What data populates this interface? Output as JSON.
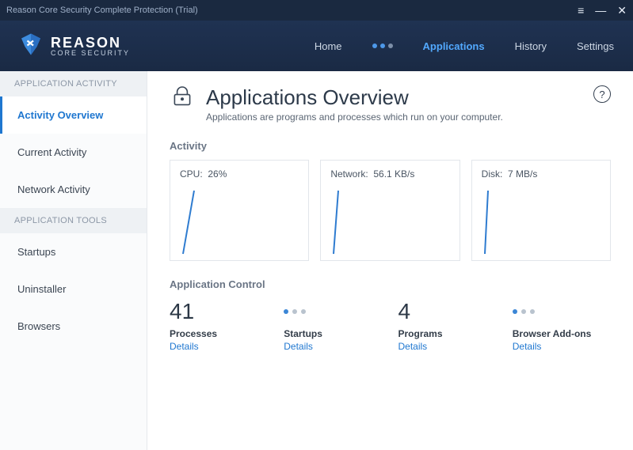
{
  "window": {
    "title": "Reason Core Security Complete Protection (Trial)"
  },
  "brand": {
    "name": "REASON",
    "sub": "CORE SECURITY"
  },
  "nav": {
    "home": "Home",
    "applications": "Applications",
    "history": "History",
    "settings": "Settings"
  },
  "sidebar": {
    "section_activity": "APPLICATION ACTIVITY",
    "section_tools": "APPLICATION TOOLS",
    "items": {
      "overview": "Activity Overview",
      "current": "Current Activity",
      "network": "Network Activity",
      "startups": "Startups",
      "uninstaller": "Uninstaller",
      "browsers": "Browsers"
    }
  },
  "page": {
    "title": "Applications Overview",
    "subtitle": "Applications are programs and processes which run on your computer."
  },
  "activity": {
    "label": "Activity",
    "cpu": {
      "name": "CPU:",
      "value": "26%"
    },
    "network": {
      "name": "Network:",
      "value": "56.1 KB/s"
    },
    "disk": {
      "name": "Disk:",
      "value": "7 MB/s"
    }
  },
  "control": {
    "label": "Application Control",
    "processes": {
      "count": "41",
      "label": "Processes",
      "link": "Details"
    },
    "startups": {
      "label": "Startups",
      "link": "Details"
    },
    "programs": {
      "count": "4",
      "label": "Programs",
      "link": "Details"
    },
    "addons": {
      "label": "Browser Add-ons",
      "link": "Details"
    }
  },
  "colors": {
    "accent": "#1f77d0",
    "header": "#1d2e4a"
  }
}
